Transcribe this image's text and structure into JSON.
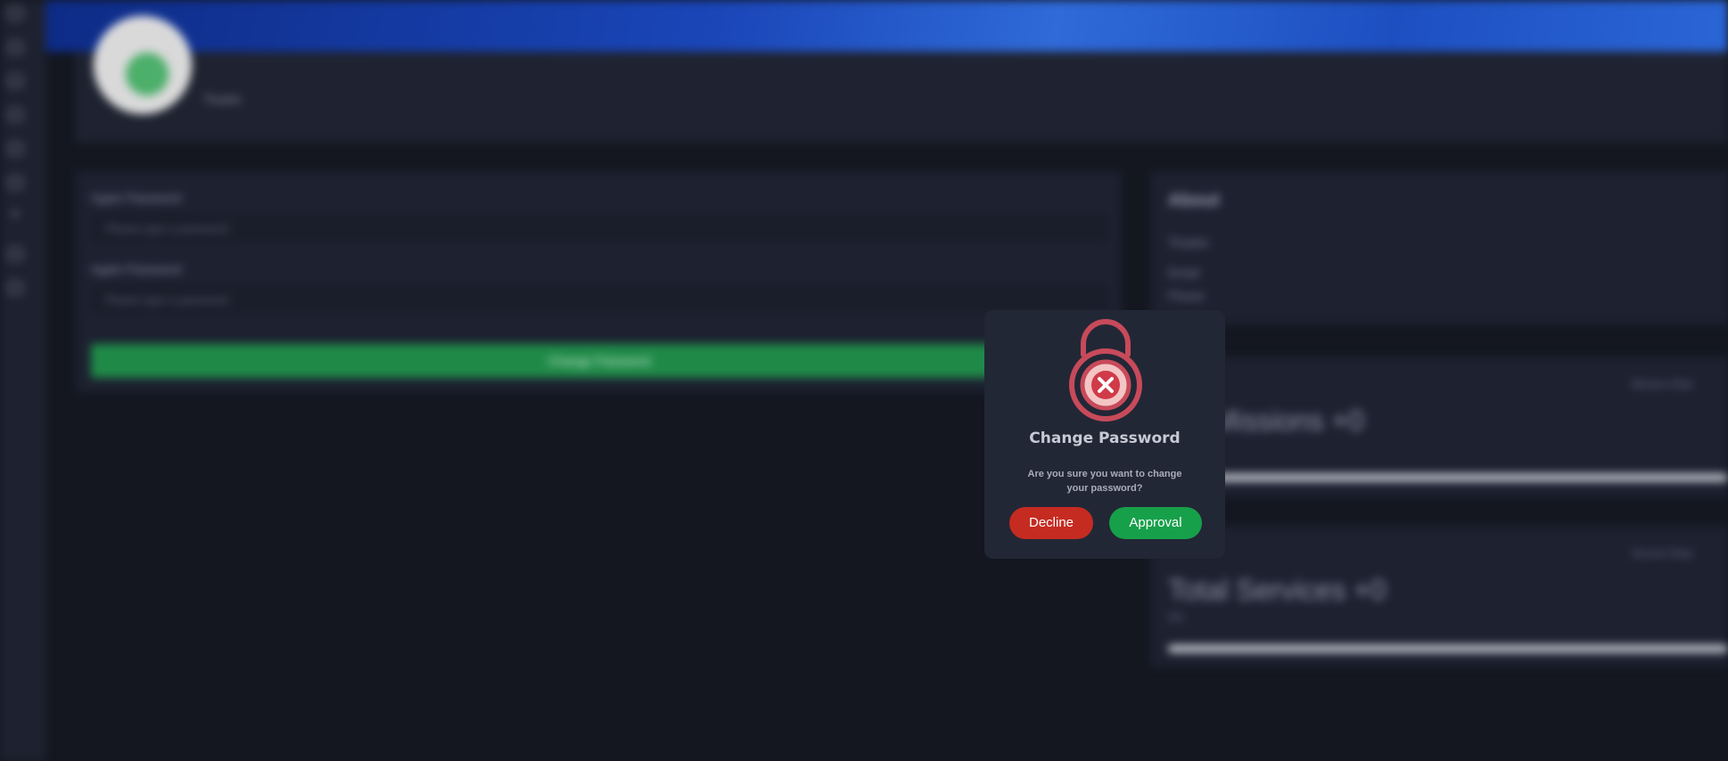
{
  "colors": {
    "accent_red": "#c52b21",
    "accent_green": "#17a04a",
    "modal_bg": "#222736",
    "page_bg": "#141720"
  },
  "sidebar": {
    "icons": [
      "wallet-icon",
      "contact-icon",
      "card-icon",
      "wallet-add-icon",
      "calendar-icon",
      "lock-icon",
      "minus-icon",
      "team-icon",
      "games-icon"
    ]
  },
  "profile": {
    "name": "Tinaelo"
  },
  "password_form": {
    "new_label": "Again Password",
    "new_placeholder": "Please type a password",
    "again_label": "Again Password",
    "again_placeholder": "Please type a password",
    "submit_label": "Change Password"
  },
  "about": {
    "title": "About",
    "name": "Tinaelo",
    "email_label": "Email",
    "phone_label": "Phone"
  },
  "missions": {
    "label": "Mission Rate",
    "value": "Missions +0"
  },
  "services": {
    "label": "Service Rate",
    "value": "Total Services +0",
    "sub": "0%"
  },
  "modal": {
    "icon": "lock-error-icon",
    "title": "Change Password",
    "message": "Are you sure you want to change your password?",
    "decline_label": "Decline",
    "approve_label": "Approval"
  }
}
